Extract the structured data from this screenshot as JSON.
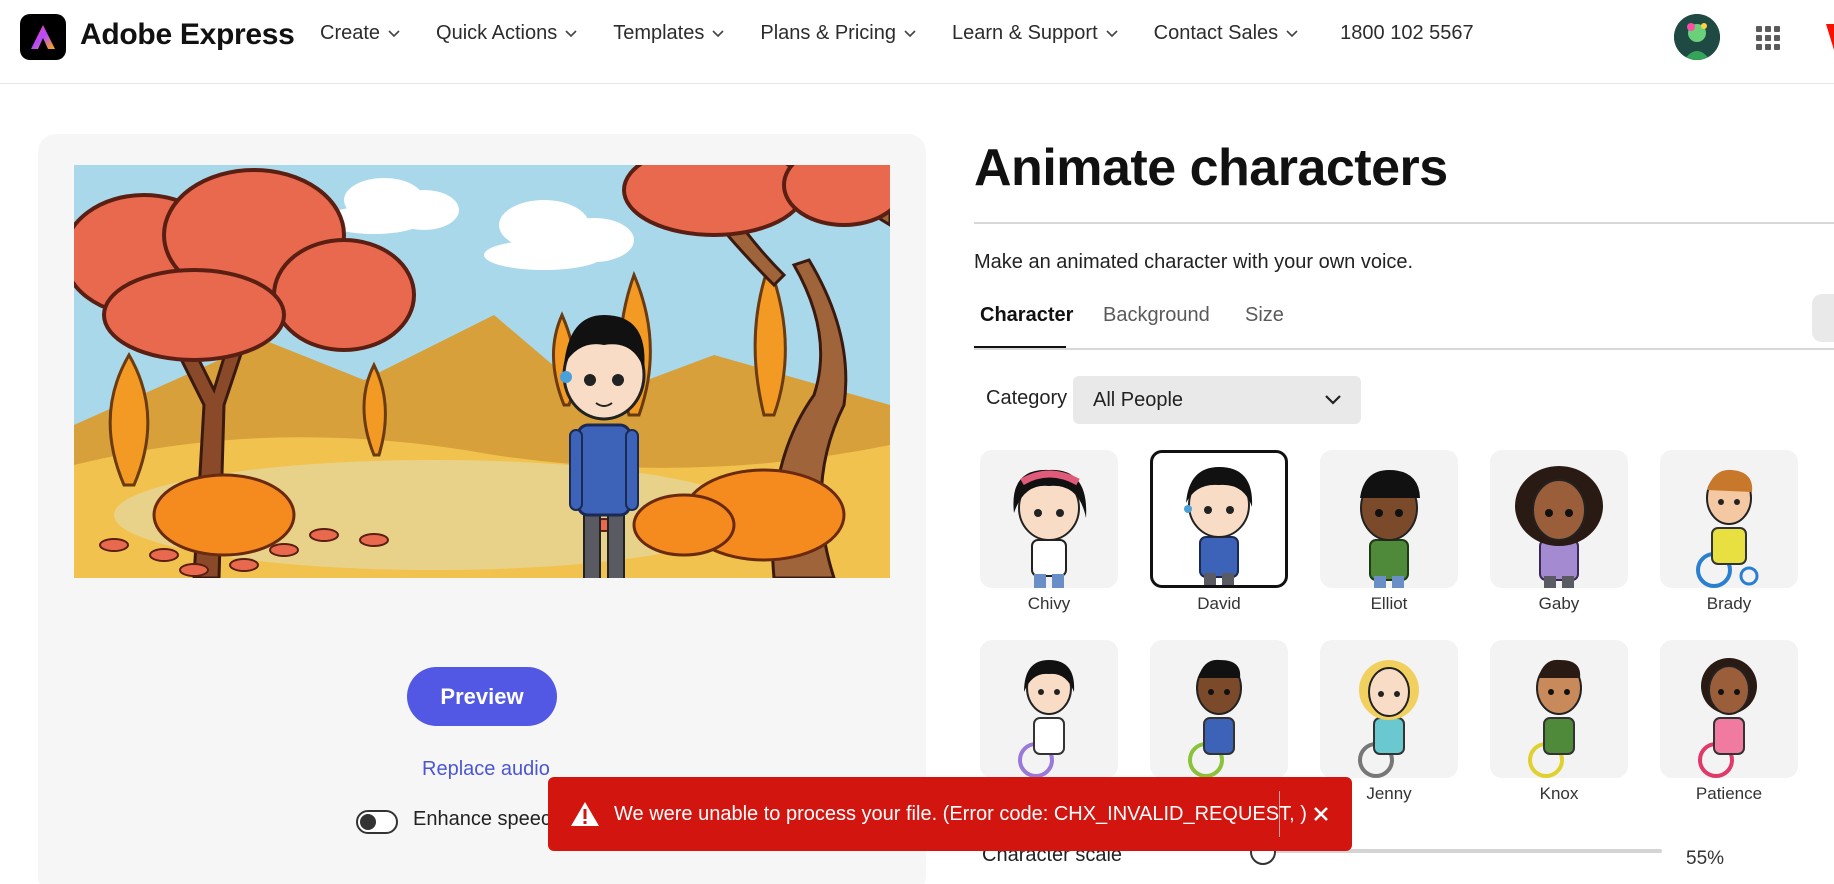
{
  "header": {
    "brand": "Adobe Express",
    "nav": [
      {
        "label": "Create"
      },
      {
        "label": "Quick Actions"
      },
      {
        "label": "Templates"
      },
      {
        "label": "Plans & Pricing"
      },
      {
        "label": "Learn & Support"
      },
      {
        "label": "Contact Sales"
      }
    ],
    "phone": "1800 102 5567",
    "icons": {
      "logo": "adobe-express-logo-icon",
      "apps": "apps-grid-icon",
      "avatar": "user-avatar"
    }
  },
  "left": {
    "preview_label": "Preview",
    "replace_audio_label": "Replace audio",
    "enhance_label": "Enhance speech",
    "enhance_on": false
  },
  "right": {
    "title": "Animate characters",
    "subtitle": "Make an animated character with your own voice.",
    "tabs": [
      {
        "label": "Character",
        "active": true
      },
      {
        "label": "Background",
        "active": false
      },
      {
        "label": "Size",
        "active": false
      }
    ],
    "category_label": "Category",
    "category_value": "All People",
    "characters": [
      {
        "name": "Chivy",
        "selected": false
      },
      {
        "name": "David",
        "selected": true
      },
      {
        "name": "Elliot",
        "selected": false
      },
      {
        "name": "Gaby",
        "selected": false
      },
      {
        "name": "Brady",
        "selected": false
      },
      {
        "name": "",
        "selected": false
      },
      {
        "name": "",
        "selected": false
      },
      {
        "name": "Jenny",
        "selected": false
      },
      {
        "name": "Knox",
        "selected": false
      },
      {
        "name": "Patience",
        "selected": false
      }
    ],
    "scale_label": "Character scale",
    "scale_value": "55%"
  },
  "toast": {
    "message": "We were unable to process your file. (Error code: CHX_INVALID_REQUEST, )",
    "color": "#d31510"
  },
  "colors": {
    "accent": "#5258e4",
    "link": "#4b56d2"
  }
}
